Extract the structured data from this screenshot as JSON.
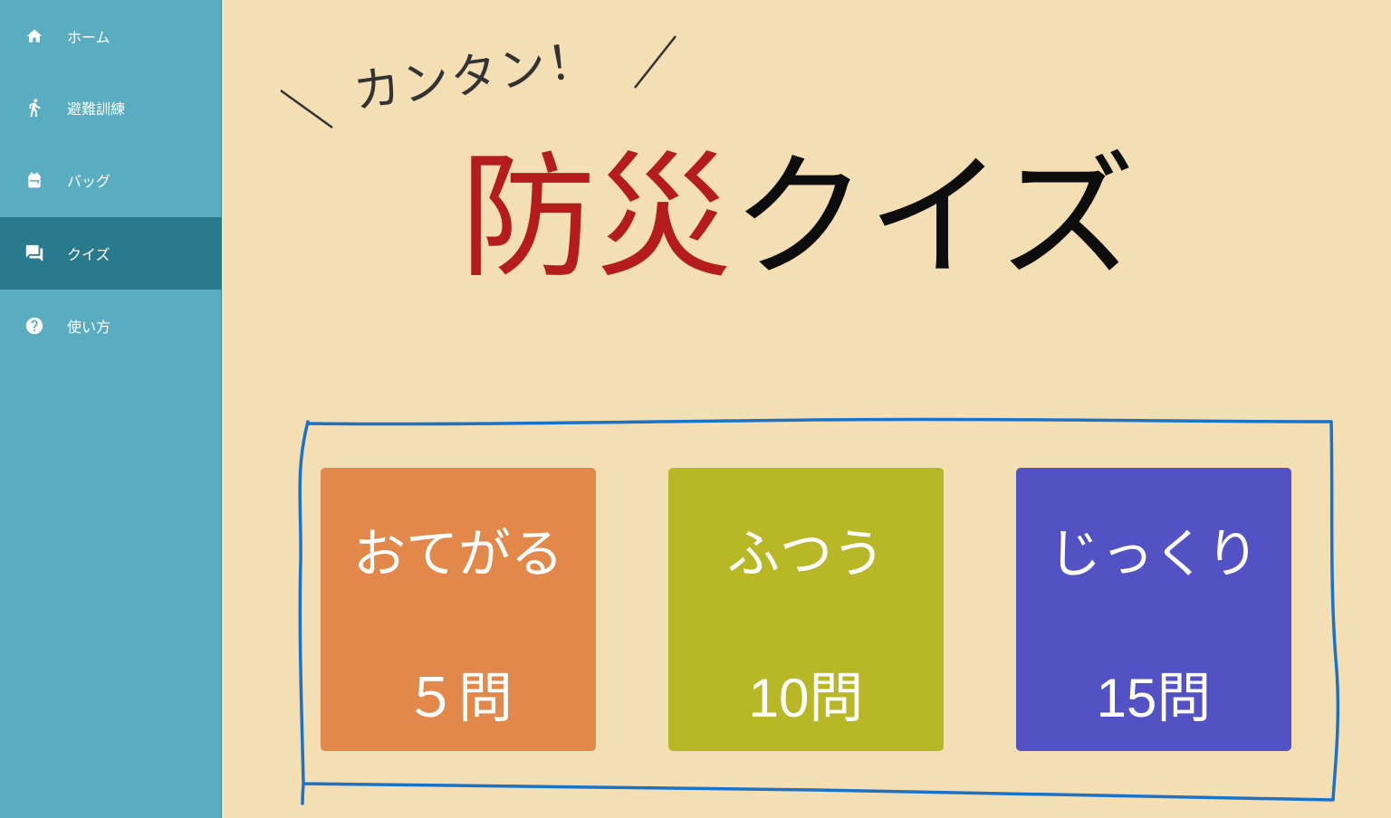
{
  "sidebar": {
    "items": [
      {
        "label": "ホーム",
        "icon": "home-icon"
      },
      {
        "label": "避難訓練",
        "icon": "running-person-icon"
      },
      {
        "label": "バッグ",
        "icon": "backpack-icon"
      },
      {
        "label": "クイズ",
        "icon": "chat-bubbles-icon",
        "active": true
      },
      {
        "label": "使い方",
        "icon": "help-circle-icon"
      }
    ]
  },
  "hero": {
    "tagline": "カンタン！",
    "title_red": "防災",
    "title_black": "クイズ"
  },
  "quiz_options": [
    {
      "title": "おてがる",
      "count": "５問",
      "color": "#e1884a"
    },
    {
      "title": "ふつう",
      "count": "10問",
      "color": "#b8b826"
    },
    {
      "title": "じっくり",
      "count": "15問",
      "color": "#5252c4"
    }
  ],
  "colors": {
    "sidebar": "#5aacc1",
    "sidebar_active": "#2a7a8d",
    "background": "#f4dfb5",
    "title_red": "#b51d1d",
    "hand_drawn_frame": "#1a73c9"
  }
}
